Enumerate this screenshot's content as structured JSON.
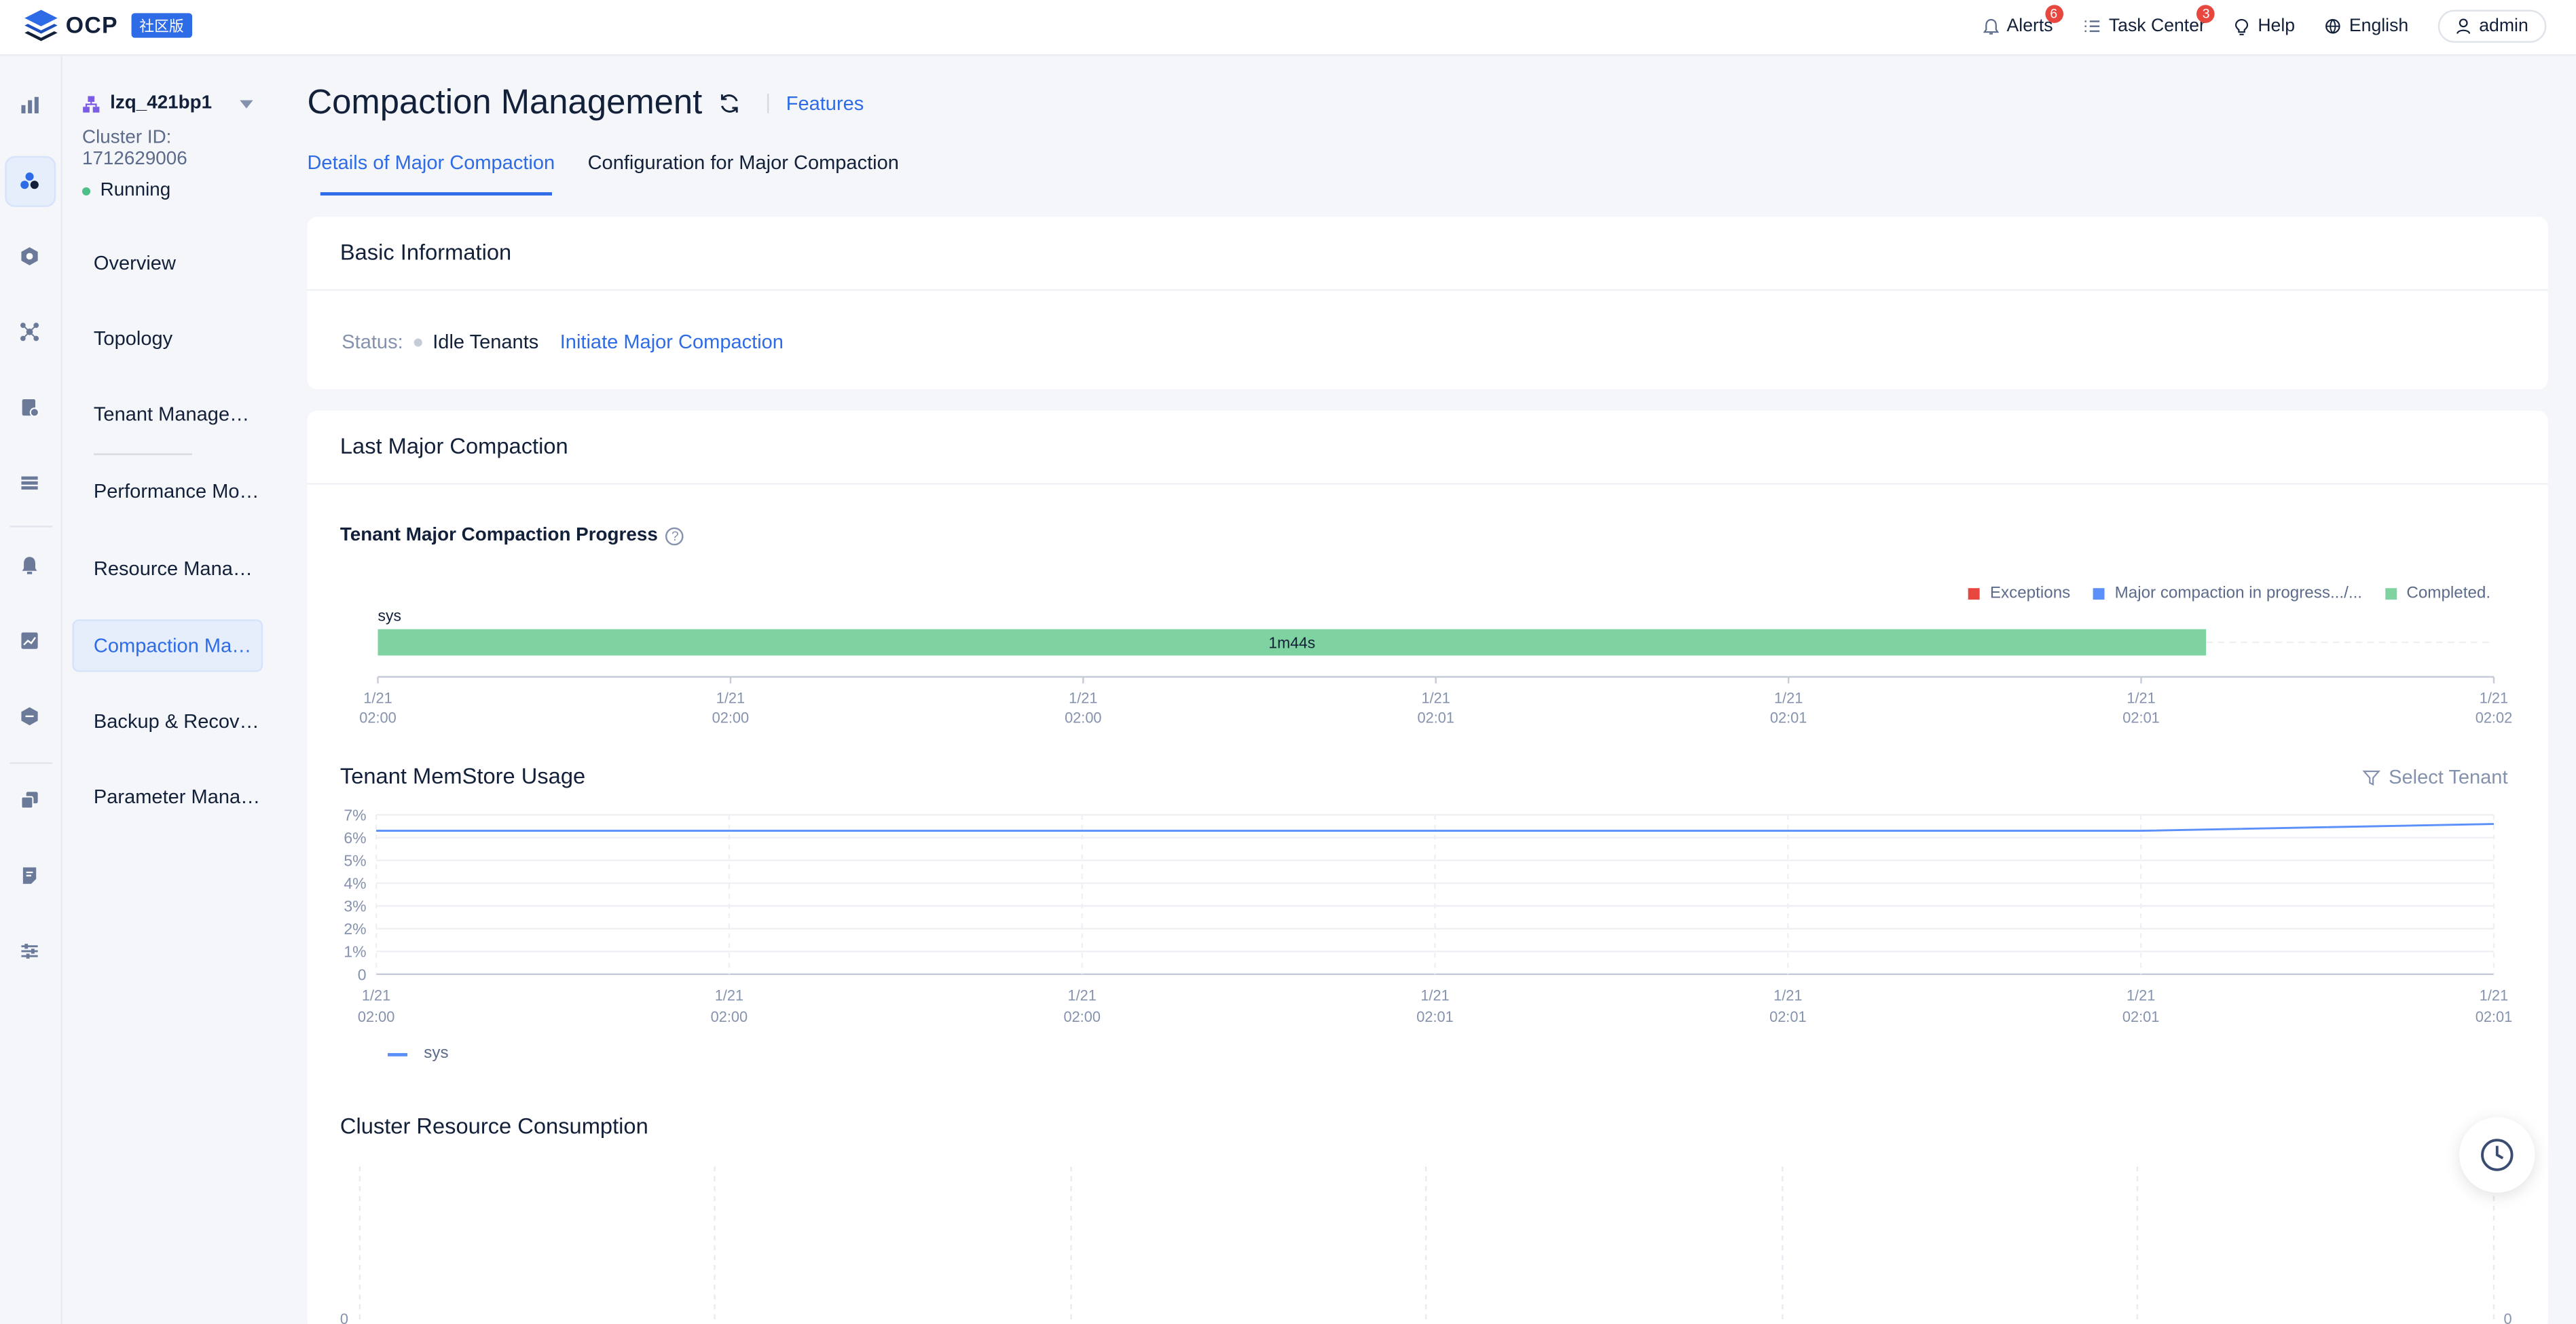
{
  "topbar": {
    "logo_text": "OCP",
    "logo_badge": "社区版",
    "alerts_label": "Alerts",
    "alerts_count": "6",
    "task_center_label": "Task Center",
    "task_center_count": "3",
    "help_label": "Help",
    "language_label": "English",
    "user_label": "admin"
  },
  "rail": {
    "icons": [
      "bar-chart-icon",
      "cluster-icon",
      "tenant-hex-icon",
      "topology-node-icon",
      "host-document-icon",
      "list-stack-icon",
      "alarm-bell-icon",
      "monitor-chart-icon",
      "backup-shield-icon",
      "copy-instances-icon",
      "log-document-icon",
      "settings-sliders-icon"
    ]
  },
  "cluster": {
    "name": "lzq_421bp1",
    "id_label": "Cluster ID:",
    "id_value": "1712629006",
    "status": "Running"
  },
  "nav": {
    "items": [
      {
        "label": "Overview"
      },
      {
        "label": "Topology"
      },
      {
        "label": "Tenant Management"
      },
      {
        "label": "Performance Monitoring"
      },
      {
        "label": "Resource Management"
      },
      {
        "label": "Compaction Management"
      },
      {
        "label": "Backup & Recovery"
      },
      {
        "label": "Parameter Management"
      }
    ]
  },
  "page": {
    "title": "Compaction Management",
    "features_link": "Features",
    "tabs": [
      {
        "label": "Details of Major Compaction",
        "active": true
      },
      {
        "label": "Configuration for Major Compaction",
        "active": false
      }
    ]
  },
  "basic_info": {
    "title": "Basic Information",
    "status_label": "Status:",
    "status_value": "Idle Tenants",
    "action_link": "Initiate Major Compaction"
  },
  "last_compaction": {
    "title": "Last Major Compaction",
    "progress_title": "Tenant Major Compaction Progress",
    "legend": [
      {
        "label": "Exceptions",
        "color": "#e8473f"
      },
      {
        "label": "Major compaction in progress.../...",
        "color": "#5b8ff9"
      },
      {
        "label": "Completed.",
        "color": "#7fd3a0"
      }
    ],
    "memstore_title": "Tenant MemStore Usage",
    "select_tenant_label": "Select Tenant",
    "memstore_legend": "sys",
    "cluster_resource_title": "Cluster Resource Consumption",
    "cluster_resource_y0_left": "0",
    "cluster_resource_y0_right": "0"
  },
  "chart_data": [
    {
      "type": "bar",
      "title": "Tenant Major Compaction Progress",
      "categories": [
        "sys"
      ],
      "series": [
        {
          "name": "Completed.",
          "values": [
            1
          ],
          "labels": [
            "1m44s"
          ],
          "color": "#7fd3a0"
        }
      ],
      "x_ticks": [
        {
          "date": "1/21",
          "time": "02:00"
        },
        {
          "date": "1/21",
          "time": "02:00"
        },
        {
          "date": "1/21",
          "time": "02:00"
        },
        {
          "date": "1/21",
          "time": "02:01"
        },
        {
          "date": "1/21",
          "time": "02:01"
        },
        {
          "date": "1/21",
          "time": "02:01"
        },
        {
          "date": "1/21",
          "time": "02:02"
        }
      ],
      "bar_fraction_of_axis": 0.864
    },
    {
      "type": "line",
      "title": "Tenant MemStore Usage",
      "y_ticks": [
        "7%",
        "6%",
        "5%",
        "4%",
        "3%",
        "2%",
        "1%",
        "0"
      ],
      "ylim": [
        0,
        7
      ],
      "x_ticks": [
        {
          "date": "1/21",
          "time": "02:00"
        },
        {
          "date": "1/21",
          "time": "02:00"
        },
        {
          "date": "1/21",
          "time": "02:00"
        },
        {
          "date": "1/21",
          "time": "02:01"
        },
        {
          "date": "1/21",
          "time": "02:01"
        },
        {
          "date": "1/21",
          "time": "02:01"
        },
        {
          "date": "1/21",
          "time": "02:01"
        }
      ],
      "series": [
        {
          "name": "sys",
          "color": "#5b8ff9",
          "values": [
            6.3,
            6.3,
            6.3,
            6.3,
            6.3,
            6.3,
            6.6
          ]
        }
      ]
    }
  ]
}
